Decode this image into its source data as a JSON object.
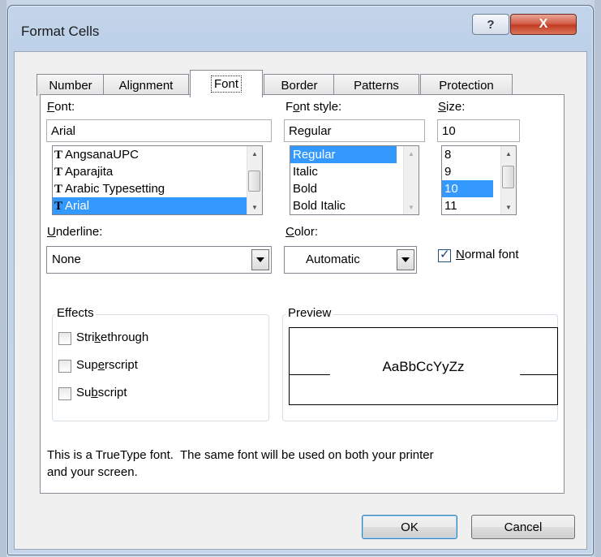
{
  "window": {
    "title": "Format Cells",
    "help_glyph": "?",
    "close_glyph": "X"
  },
  "tabs": [
    {
      "label": "Number"
    },
    {
      "label": "Alignment"
    },
    {
      "label": "Font",
      "active": true
    },
    {
      "label": "Border"
    },
    {
      "label": "Patterns"
    },
    {
      "label": "Protection"
    }
  ],
  "font": {
    "label_prefix": "F",
    "label_rest": "ont:",
    "value": "Arial",
    "list": [
      "AngsanaUPC",
      "Aparajita",
      "Arabic Typesetting",
      "Arial"
    ],
    "selected": "Arial",
    "icon_glyph": "T"
  },
  "font_style": {
    "label_pre": "F",
    "label_ul": "o",
    "label_rest": "nt style:",
    "value": "Regular",
    "list": [
      "Regular",
      "Italic",
      "Bold",
      "Bold Italic"
    ],
    "selected": "Regular"
  },
  "size": {
    "label_ul": "S",
    "label_rest": "ize:",
    "value": "10",
    "list": [
      "8",
      "9",
      "10",
      "11"
    ],
    "selected": "10"
  },
  "underline": {
    "label_ul": "U",
    "label_rest": "nderline:",
    "value": "None"
  },
  "color": {
    "label_ul": "C",
    "label_rest": "olor:",
    "value": "Automatic"
  },
  "normal_font": {
    "label_ul": "N",
    "label_rest": "ormal font",
    "checked": true
  },
  "effects": {
    "title": "Effects",
    "items": [
      {
        "pre": "Stri",
        "ul": "k",
        "post": "ethrough",
        "checked": false
      },
      {
        "pre": "Sup",
        "ul": "e",
        "post": "rscript",
        "checked": false
      },
      {
        "pre": "Su",
        "ul": "b",
        "post": "script",
        "checked": false
      }
    ]
  },
  "preview": {
    "title": "Preview",
    "sample": "AaBbCcYyZz"
  },
  "info_text_line1": "This is a TrueType font.  The same font will be used on both your printer",
  "info_text_line2": "and your screen.",
  "buttons": {
    "ok": "OK",
    "cancel": "Cancel"
  },
  "colors": {
    "selection": "#3399ff",
    "close_button": "#c23b22",
    "dialog_bg": "#f0f0f0"
  }
}
